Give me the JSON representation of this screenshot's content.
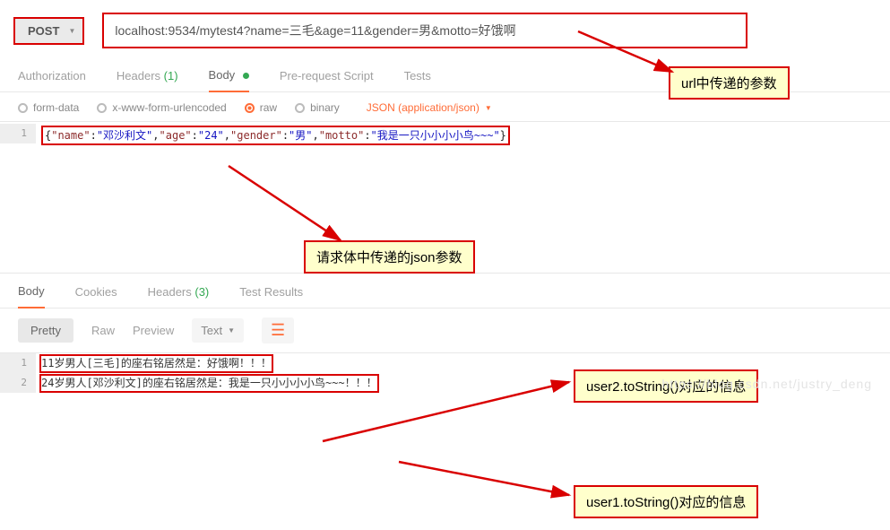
{
  "request": {
    "method": "POST",
    "url": "localhost:9534/mytest4?name=三毛&age=11&gender=男&motto=好饿啊"
  },
  "tabs": {
    "authorization": "Authorization",
    "headers": "Headers",
    "headers_count": "(1)",
    "body": "Body",
    "pre_request": "Pre-request Script",
    "tests": "Tests"
  },
  "body_types": {
    "form_data": "form-data",
    "urlencoded": "x-www-form-urlencoded",
    "raw": "raw",
    "binary": "binary",
    "json_label": "JSON (application/json)"
  },
  "request_body": {
    "line_num": "1",
    "raw": "{\"name\":\"邓沙利文\",\"age\":\"24\",\"gender\":\"男\",\"motto\":\"我是一只小小小小鸟~~~\"}",
    "keys": [
      "name",
      "age",
      "gender",
      "motto"
    ],
    "values": [
      "邓沙利文",
      "24",
      "男",
      "我是一只小小小小鸟~~~"
    ]
  },
  "res_tabs": {
    "body": "Body",
    "cookies": "Cookies",
    "headers": "Headers",
    "headers_count": "(3)",
    "test_results": "Test Results"
  },
  "res_view": {
    "pretty": "Pretty",
    "raw": "Raw",
    "preview": "Preview",
    "text": "Text"
  },
  "response": {
    "lines": [
      {
        "num": "1",
        "text": "11岁男人[三毛]的座右铭居然是：好饿啊！！！"
      },
      {
        "num": "2",
        "text": "24岁男人[邓沙利文]的座右铭居然是：我是一只小小小小鸟~~~！！！"
      }
    ]
  },
  "annotations": {
    "url_params": "url中传递的参数",
    "json_params": "请求体中传递的json参数",
    "user2": "user2.toString()对应的信息",
    "user1": "user1.toString()对应的信息"
  },
  "watermark": "https://blog.csdn.net/justry_deng"
}
